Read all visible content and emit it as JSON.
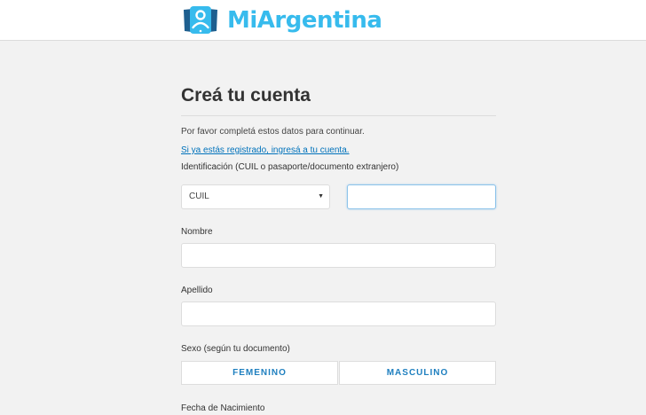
{
  "header": {
    "brand": "MiArgentina",
    "logo_icon": "person-badge-icon",
    "brand_color": "#37bbed"
  },
  "form": {
    "title": "Creá tu cuenta",
    "intro": "Por favor completá estos datos para continuar.",
    "login_link": "Si ya estás registrado, ingresá a tu cuenta.",
    "identification": {
      "label": "Identificación (CUIL o pasaporte/documento extranjero)",
      "type_selected": "CUIL",
      "caret_glyph": "▼",
      "number_value": ""
    },
    "nombre": {
      "label": "Nombre",
      "value": ""
    },
    "apellido": {
      "label": "Apellido",
      "value": ""
    },
    "sexo": {
      "label": "Sexo (según tu documento)",
      "options": [
        "FEMENINO",
        "MASCULINO"
      ]
    },
    "birth": {
      "label": "Fecha de Nacimiento"
    }
  },
  "colors": {
    "link": "#0072bb",
    "button_text": "#1e7fbf",
    "background": "#f2f2f2"
  }
}
